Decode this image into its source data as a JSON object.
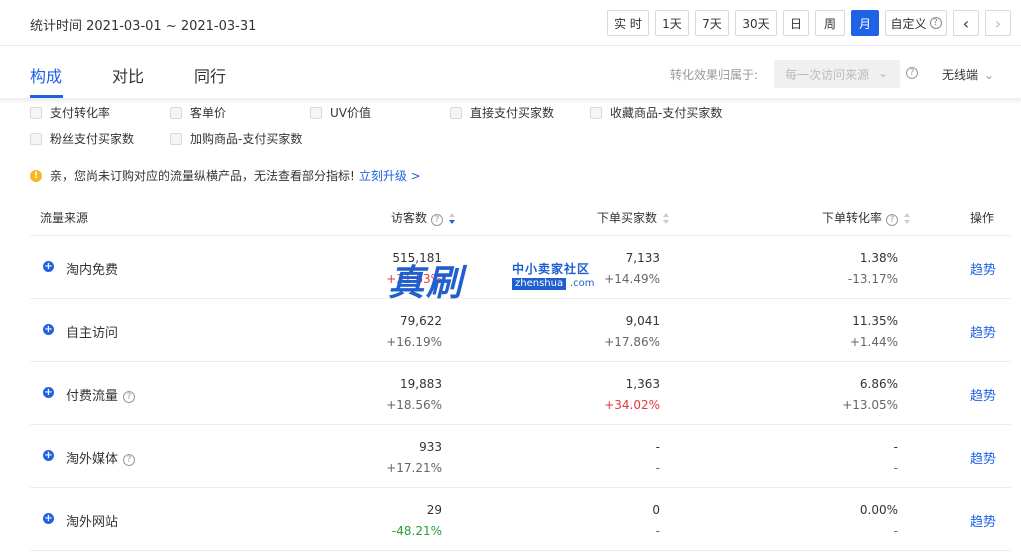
{
  "top": {
    "date_range": "统计时间 2021-03-01 ~ 2021-03-31",
    "buttons": [
      "实 时",
      "1天",
      "7天",
      "30天",
      "日",
      "周",
      "月",
      "自定义"
    ],
    "active": "月",
    "prev": "‹",
    "next": "›",
    "help_glyph": "?"
  },
  "tabs": [
    "构成",
    "对比",
    "同行"
  ],
  "active_tab": "构成",
  "attribution": {
    "label": "转化效果归属于:",
    "value": "每一次访问来源",
    "chevron": "⌄"
  },
  "device": {
    "label": "无线端",
    "chevron": "⌄"
  },
  "metrics": [
    "支付转化率",
    "客单价",
    "UV价值",
    "直接支付买家数",
    "收藏商品-支付买家数",
    "粉丝支付买家数",
    "加购商品-支付买家数"
  ],
  "notice": {
    "icon": "!",
    "text": "亲，您尚未订购对应的流量纵横产品，无法查看部分指标!",
    "link": "立刻升级 >"
  },
  "table": {
    "headers": {
      "source": "流量来源",
      "visitors": "访客数",
      "buyers": "下单买家数",
      "conversion": "下单转化率",
      "action": "操作"
    },
    "expand_glyph": "+",
    "rows": [
      {
        "source": "淘内免费",
        "has_help": false,
        "visitors": "515,181",
        "visitors_delta": "+31.63%",
        "visitors_dir": "up",
        "buyers": "7,133",
        "buyers_delta": "+14.49%",
        "buyers_dir": "none",
        "conv": "1.38%",
        "conv_delta": "-13.17%",
        "conv_dir": "none",
        "action": "趋势"
      },
      {
        "source": "自主访问",
        "has_help": false,
        "visitors": "79,622",
        "visitors_delta": "+16.19%",
        "visitors_dir": "none",
        "buyers": "9,041",
        "buyers_delta": "+17.86%",
        "buyers_dir": "none",
        "conv": "11.35%",
        "conv_delta": "+1.44%",
        "conv_dir": "none",
        "action": "趋势"
      },
      {
        "source": "付费流量",
        "has_help": true,
        "visitors": "19,883",
        "visitors_delta": "+18.56%",
        "visitors_dir": "none",
        "buyers": "1,363",
        "buyers_delta": "+34.02%",
        "buyers_dir": "up",
        "conv": "6.86%",
        "conv_delta": "+13.05%",
        "conv_dir": "none",
        "action": "趋势"
      },
      {
        "source": "淘外媒体",
        "has_help": true,
        "visitors": "933",
        "visitors_delta": "+17.21%",
        "visitors_dir": "none",
        "buyers": "-",
        "buyers_delta": "-",
        "buyers_dir": "none",
        "conv": "-",
        "conv_delta": "-",
        "conv_dir": "none",
        "action": "趋势"
      },
      {
        "source": "淘外网站",
        "has_help": false,
        "visitors": "29",
        "visitors_delta": "-48.21%",
        "visitors_dir": "down",
        "buyers": "0",
        "buyers_delta": "-",
        "buyers_dir": "none",
        "conv": "0.00%",
        "conv_delta": "-",
        "conv_dir": "none",
        "action": "趋势"
      }
    ]
  },
  "watermark": {
    "big": "真刷",
    "small": "中小卖家社区",
    "url": "zhenshua",
    "suffix": ".com"
  }
}
